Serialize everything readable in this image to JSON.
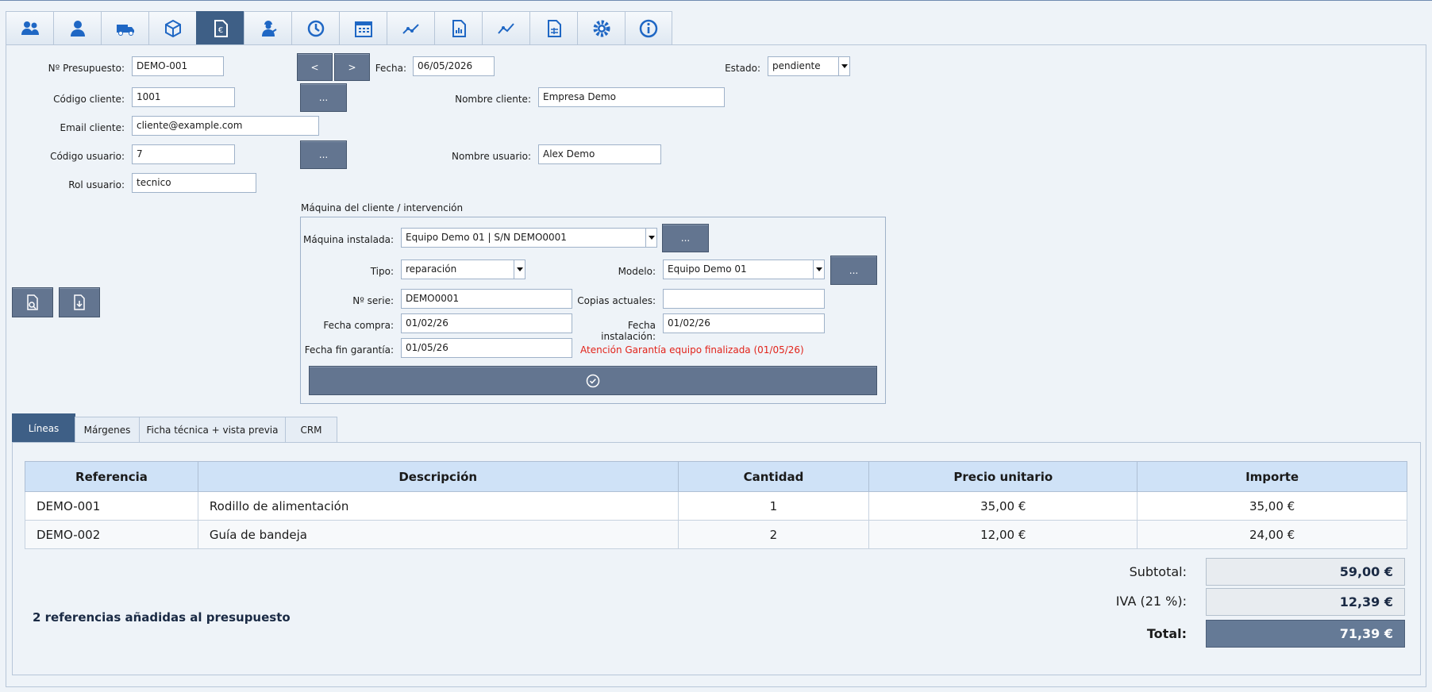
{
  "toolbar": {
    "icons": [
      "users-icon",
      "user-icon",
      "truck-icon",
      "package-icon",
      "budget-document-icon",
      "technician-icon",
      "clock-icon",
      "calendar-icon",
      "line-chart-icon",
      "report-icon",
      "trend-chart-icon",
      "spreadsheet-icon",
      "gear-icon",
      "info-icon"
    ],
    "active_index": 4
  },
  "form": {
    "presupuesto_label": "Nº Presupuesto:",
    "presupuesto_value": "DEMO-001",
    "prev_label": "<",
    "next_label": ">",
    "fecha_label": "Fecha:",
    "fecha_value": "06/05/2026",
    "estado_label": "Estado:",
    "estado_value": "pendiente",
    "codigo_cliente_label": "Código cliente:",
    "codigo_cliente_value": "1001",
    "browse_label": "...",
    "nombre_cliente_label": "Nombre cliente:",
    "nombre_cliente_value": "Empresa Demo",
    "email_label": "Email cliente:",
    "email_value": "cliente@example.com",
    "codigo_usuario_label": "Código usuario:",
    "codigo_usuario_value": "7",
    "nombre_usuario_label": "Nombre usuario:",
    "nombre_usuario_value": "Alex Demo",
    "rol_label": "Rol usuario:",
    "rol_value": "tecnico"
  },
  "machine": {
    "group_title": "Máquina del cliente / intervención",
    "instalada_label": "Máquina instalada:",
    "instalada_value": "Equipo Demo 01 | S/N DEMO0001",
    "tipo_label": "Tipo:",
    "tipo_value": "reparación",
    "modelo_label": "Modelo:",
    "modelo_value": "Equipo Demo 01",
    "serie_label": "Nº serie:",
    "serie_value": "DEMO0001",
    "copias_label": "Copias actuales:",
    "copias_value": "",
    "fecha_compra_label": "Fecha compra:",
    "fecha_compra_value": "01/02/26",
    "fecha_instalacion_label": "Fecha instalación:",
    "fecha_instalacion_value": "01/02/26",
    "fin_garantia_label": "Fecha fin garantía:",
    "fin_garantia_value": "01/05/26",
    "warning": "Atención Garantía equipo finalizada (01/05/26)"
  },
  "tabs": [
    {
      "label": "Líneas",
      "active": true
    },
    {
      "label": "Márgenes",
      "active": false
    },
    {
      "label": "Ficha técnica + vista previa",
      "active": false
    },
    {
      "label": "CRM",
      "active": false
    }
  ],
  "table": {
    "headers": [
      "Referencia",
      "Descripción",
      "Cantidad",
      "Precio unitario",
      "Importe"
    ],
    "rows": [
      [
        "DEMO-001",
        "Rodillo de alimentación",
        "1",
        "35,00 €",
        "35,00 €"
      ],
      [
        "DEMO-002",
        "Guía de bandeja",
        "2",
        "12,00 €",
        "24,00 €"
      ]
    ]
  },
  "summary": {
    "count_text": "2 referencias añadidas al presupuesto",
    "subtotal_label": "Subtotal:",
    "subtotal_value": "59,00 €",
    "iva_label": "IVA (21 %):",
    "iva_value": "12,39 €",
    "total_label": "Total:",
    "total_value": "71,39 €"
  },
  "colors": {
    "accent": "#3e5f86",
    "button": "#637590",
    "warning": "#e2231a",
    "header_bg": "#cfe2f7"
  }
}
